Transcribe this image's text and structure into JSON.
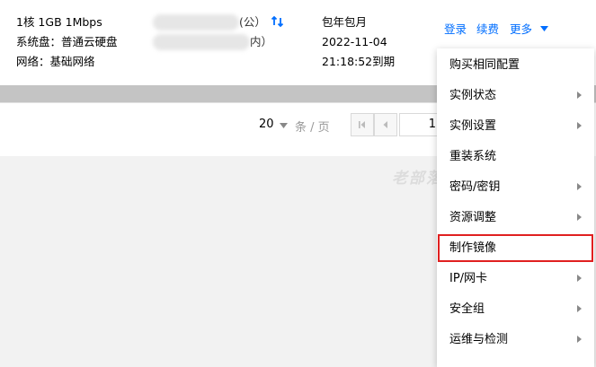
{
  "instance": {
    "spec": "1核 1GB 1Mbps",
    "disk": "系统盘：普通云硬盘",
    "network": "网络：基础网络",
    "ip_suffix_1": "(公）",
    "ip_suffix_2": "内）",
    "billing_type": "包年包月",
    "expire_date": "2022-11-04",
    "expire_time": "21:18:52到期"
  },
  "actions": {
    "login": "登录",
    "renew": "续费",
    "more": "更多"
  },
  "pager": {
    "page_size": "20",
    "unit": "条 / 页",
    "current_page": "1"
  },
  "watermark": "老部落",
  "menu": {
    "items": [
      {
        "label": "购买相同配置",
        "submenu": false
      },
      {
        "label": "实例状态",
        "submenu": true
      },
      {
        "label": "实例设置",
        "submenu": true
      },
      {
        "label": "重装系统",
        "submenu": false
      },
      {
        "label": "密码/密钥",
        "submenu": true
      },
      {
        "label": "资源调整",
        "submenu": true
      },
      {
        "label": "制作镜像",
        "submenu": false,
        "highlighted": true
      },
      {
        "label": "IP/网卡",
        "submenu": true
      },
      {
        "label": "安全组",
        "submenu": true
      },
      {
        "label": "运维与检测",
        "submenu": true
      }
    ]
  },
  "colors": {
    "link": "#006eff",
    "highlight_border": "#e02020"
  }
}
